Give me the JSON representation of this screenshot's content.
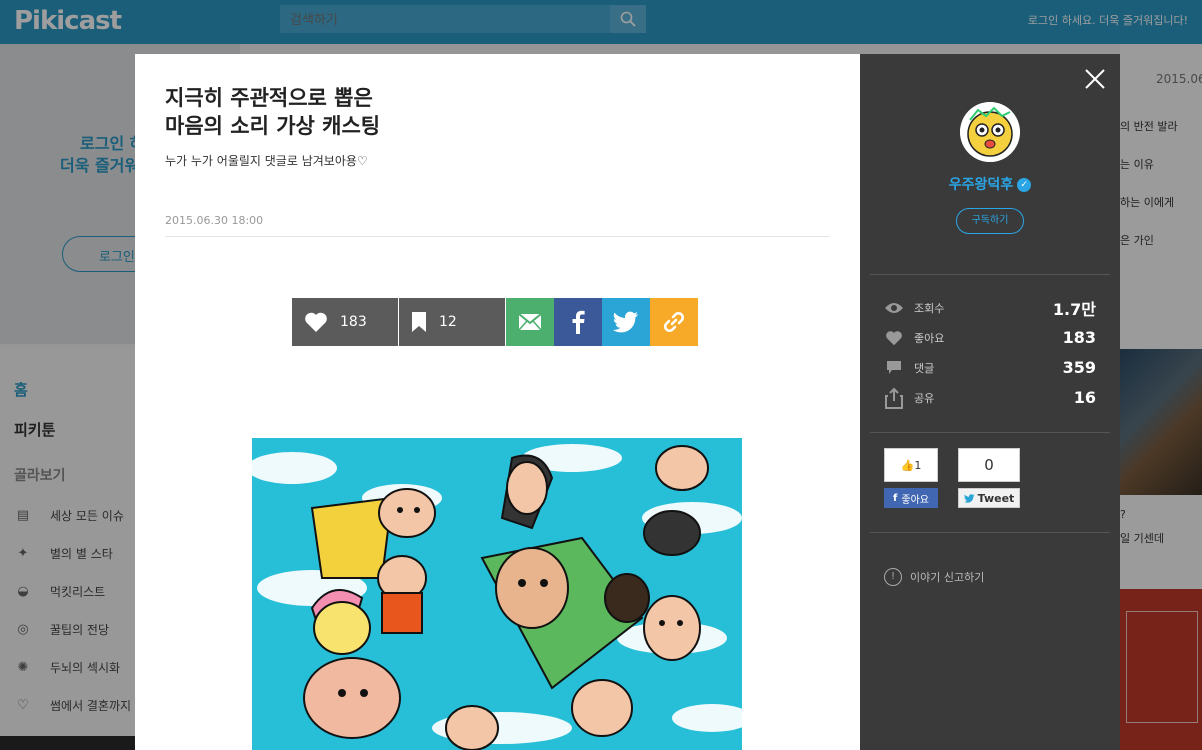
{
  "topbar": {
    "logo": "Pikicast",
    "search_placeholder": "검색하기",
    "login_message": "로그인 하세요. 더욱 즐거워집니다!"
  },
  "background": {
    "promo_line1": "로그인 하",
    "promo_line2": "더욱 즐거워",
    "login_button": "로그인",
    "nav": {
      "home": "홈",
      "pikitoon": "피키툰",
      "browse": "골라보기",
      "items": [
        {
          "label": "세상 모든 이슈",
          "icon": "news-icon"
        },
        {
          "label": "별의 별 스타",
          "icon": "star-icon"
        },
        {
          "label": "먹킷리스트",
          "icon": "food-icon"
        },
        {
          "label": "꿀팁의 전당",
          "icon": "honey-pot-icon"
        },
        {
          "label": "두뇌의 섹시화",
          "icon": "lightbulb-icon"
        },
        {
          "label": "썸에서 결혼까지",
          "icon": "heart-icon"
        }
      ]
    },
    "right": {
      "date": "2015.06.",
      "texts": [
        "의 반전 발라",
        "는 이유",
        "하는 이에게",
        "은 가인",
        "?",
        "일 기센데"
      ]
    }
  },
  "article": {
    "title_line1": "지극히 주관적으로 뽑은",
    "title_line2": "마음의 소리 가상 캐스팅",
    "subtitle": "누가 누가 어울릴지 댓글로 남겨보아용♡",
    "date": "2015.06.30 18:00",
    "likes": "183",
    "bookmarks": "12"
  },
  "sidebar": {
    "author": "우주왕덕후",
    "subscribe": "구독하기",
    "stats": [
      {
        "label": "조회수",
        "value": "1.7만",
        "icon": "eye-icon"
      },
      {
        "label": "좋아요",
        "value": "183",
        "icon": "heart-icon"
      },
      {
        "label": "댓글",
        "value": "359",
        "icon": "comment-icon"
      },
      {
        "label": "공유",
        "value": "16",
        "icon": "share-icon"
      }
    ],
    "fb_like_count": "1",
    "fb_like_label": "좋아요",
    "tweet_count": "0",
    "tweet_label": "Tweet",
    "report": "이야기 신고하기"
  },
  "colors": {
    "brand": "#2a98c5",
    "mail": "#4caf6d",
    "facebook": "#3b5998",
    "twitter": "#2aa5d6",
    "link": "#f7a928",
    "sidebar_bg": "#3a3a3a",
    "author": "#2aa5e5"
  }
}
